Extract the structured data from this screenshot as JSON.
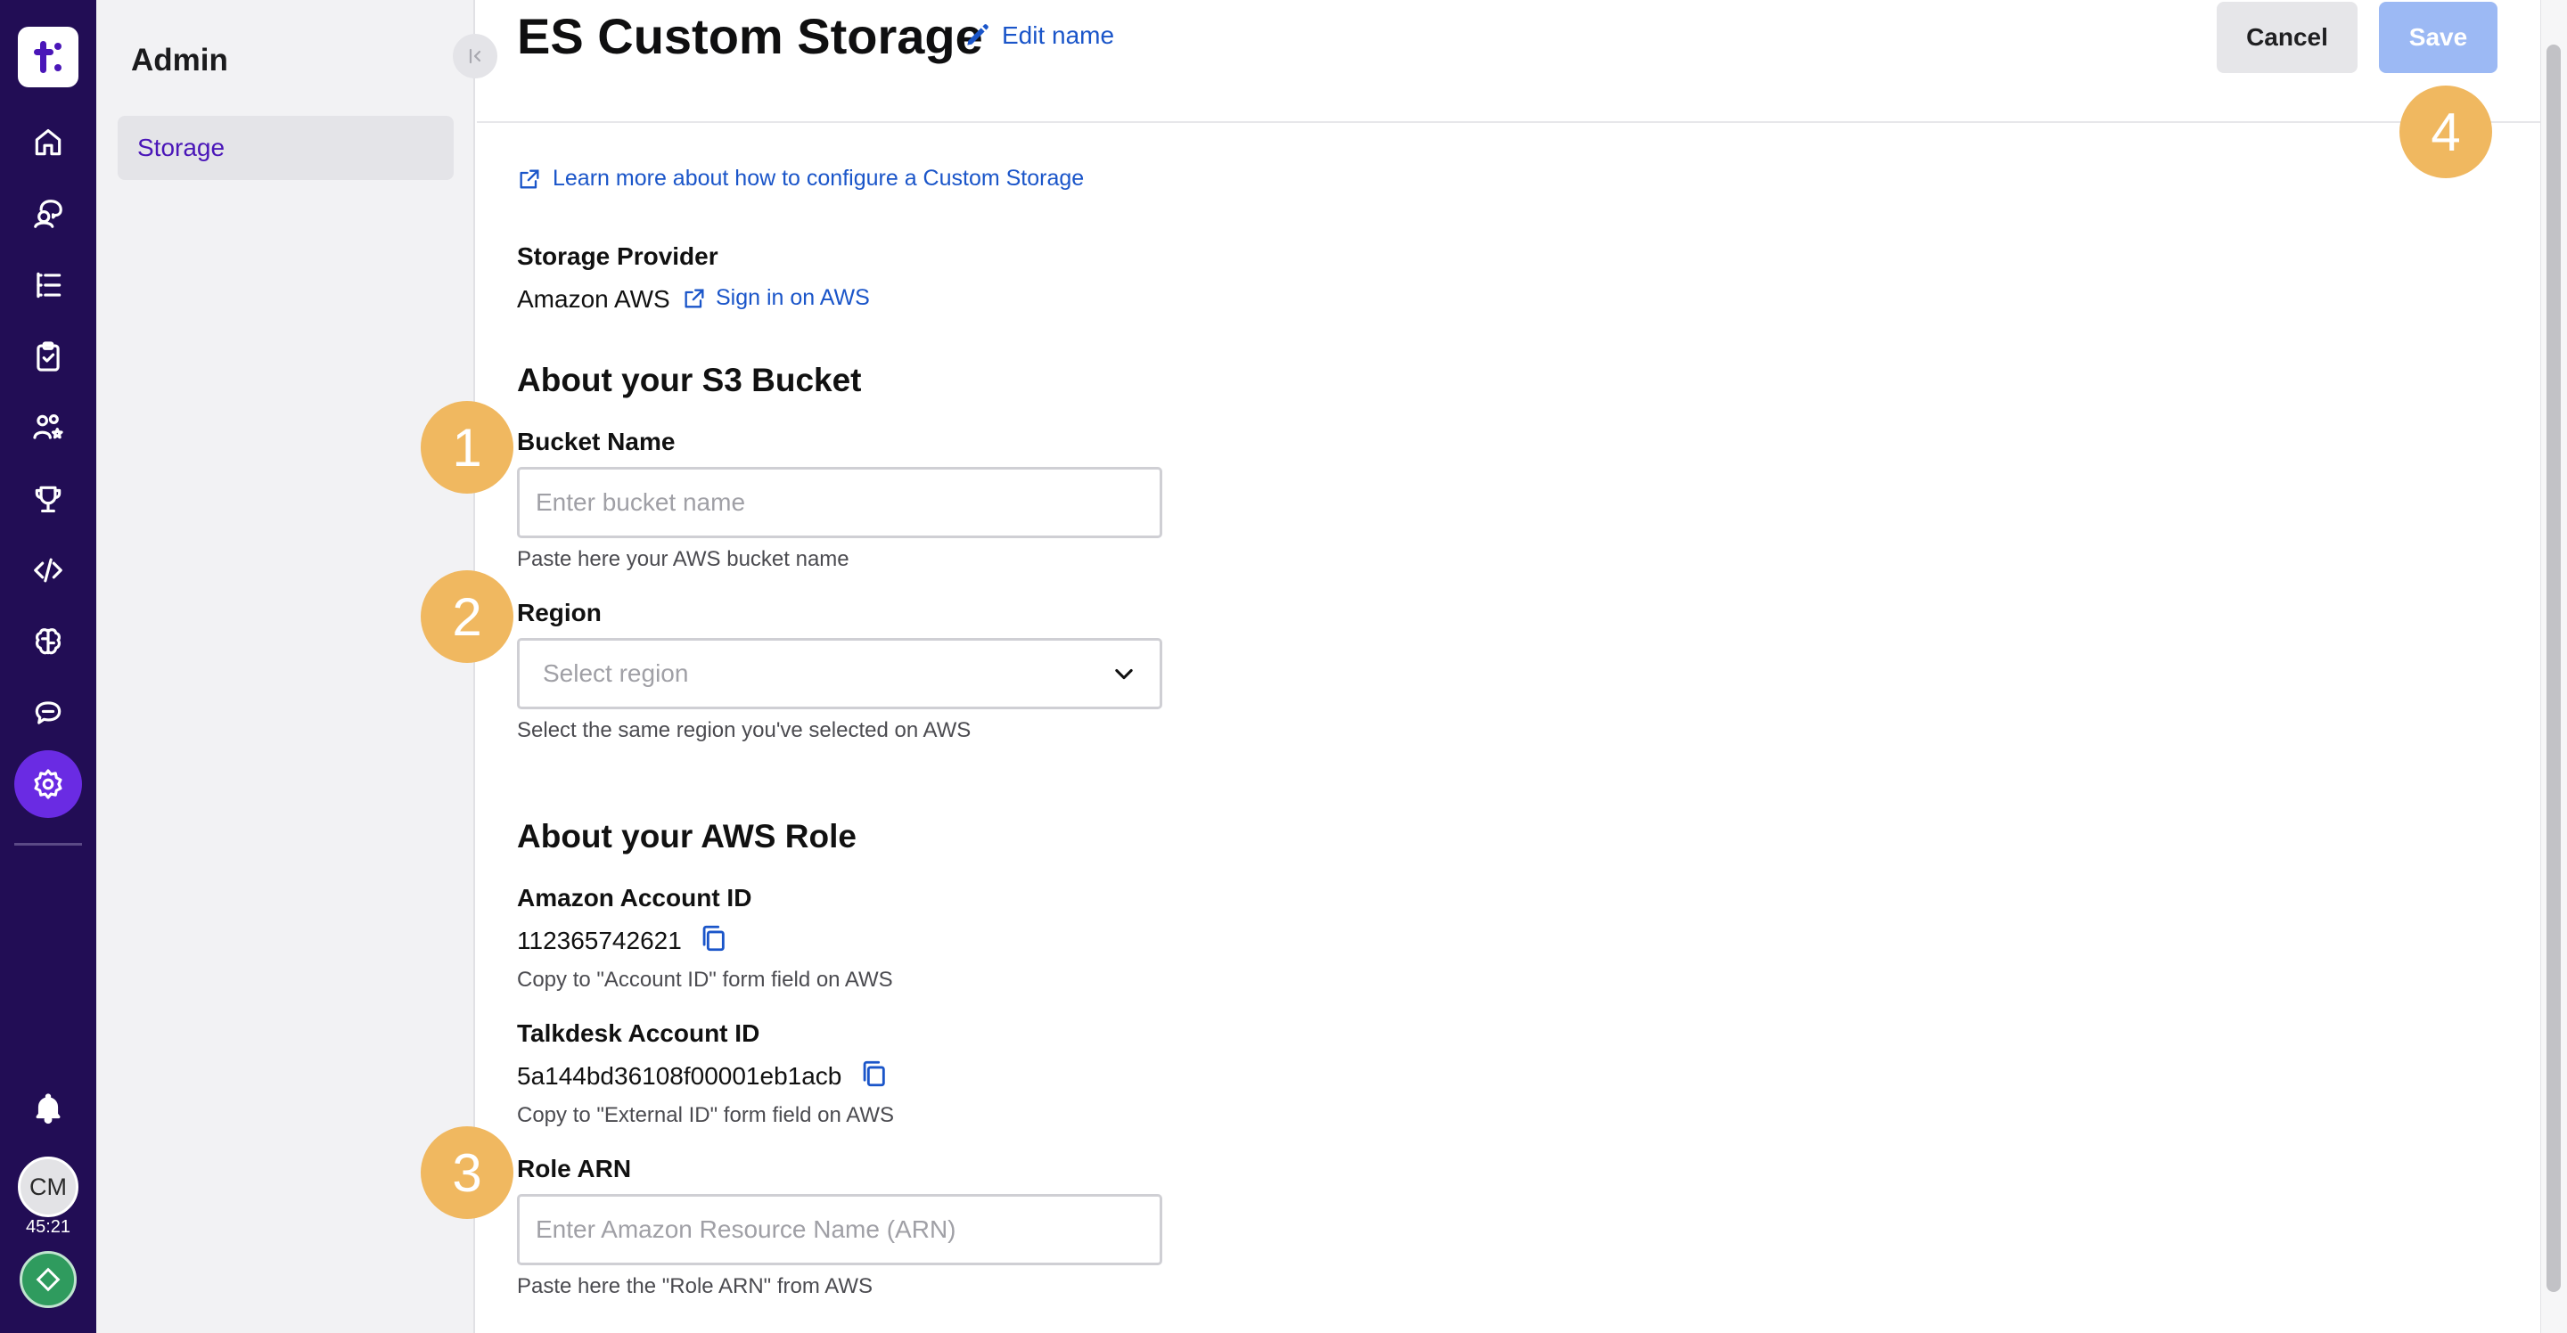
{
  "rail": {
    "logo_letter": "t",
    "icons": [
      "home-icon",
      "agent-icon",
      "list-icon",
      "clipboard-icon",
      "people-icon",
      "trophy-icon",
      "code-icon",
      "brain-icon",
      "chat-icon",
      "settings-icon"
    ],
    "notification_icon": "bell-icon",
    "avatar_initials": "CM",
    "timer": "45:21",
    "status_color": "#2f9b5e"
  },
  "sidepanel": {
    "title": "Admin",
    "items": [
      {
        "label": "Storage"
      }
    ]
  },
  "header": {
    "title": "ES Custom Storage",
    "edit_label": "Edit name",
    "cancel_label": "Cancel",
    "save_label": "Save"
  },
  "content": {
    "learn_link": "Learn more about how to configure a Custom Storage",
    "provider": {
      "label": "Storage Provider",
      "value": "Amazon AWS",
      "link": "Sign in on AWS"
    },
    "bucket_section": {
      "title": "About your S3 Bucket",
      "bucket_name": {
        "label": "Bucket Name",
        "placeholder": "Enter bucket name",
        "value": "",
        "helper": "Paste here your AWS bucket name"
      },
      "region": {
        "label": "Region",
        "placeholder": "Select region",
        "helper": "Select the same region you've selected on AWS"
      }
    },
    "role_section": {
      "title": "About your AWS Role",
      "amazon_account": {
        "label": "Amazon Account ID",
        "value": "112365742621",
        "helper": "Copy to \"Account ID\" form field on AWS"
      },
      "talkdesk_account": {
        "label": "Talkdesk Account ID",
        "value": "5a144bd36108f00001eb1acb",
        "helper": "Copy to \"External ID\" form field on AWS"
      },
      "role_arn": {
        "label": "Role ARN",
        "placeholder": "Enter Amazon Resource Name (ARN)",
        "value": "",
        "helper": "Paste here the \"Role ARN\" from AWS"
      }
    }
  },
  "annotations": [
    "1",
    "2",
    "3",
    "4"
  ],
  "colors": {
    "rail_bg": "#220d55",
    "accent": "#6a2be3",
    "link": "#1a55c9",
    "save_disabled": "#9cb9f4",
    "badge": "#f0b860"
  }
}
